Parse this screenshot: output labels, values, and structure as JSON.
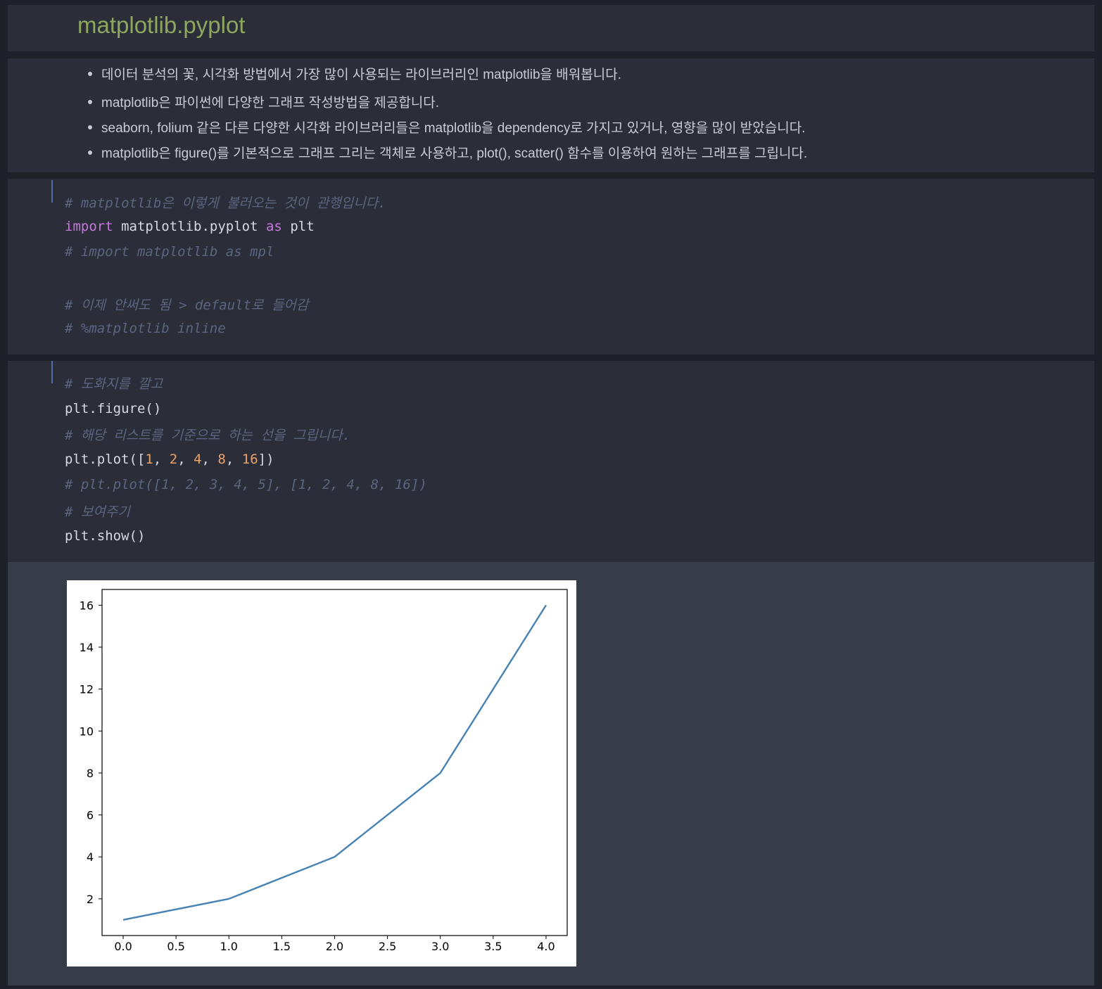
{
  "header": {
    "title": "matplotlib.pyplot"
  },
  "bullets": [
    "데이터 분석의 꽃, 시각화 방법에서 가장 많이 사용되는 라이브러리인 matplotlib을 배워봅니다.",
    "matplotlib은 파이썬에 다양한 그래프 작성방법을 제공합니다.",
    "seaborn, folium 같은 다른 다양한 시각화 라이브러리들은 matplotlib을 dependency로 가지고 있거나, 영향을 많이 받았습니다.",
    "matplotlib은 figure()를 기본적으로 그래프 그리는 객체로 사용하고, plot(), scatter() 함수를 이용하여 원하는 그래프를 그립니다."
  ],
  "code1": {
    "l1": "# matplotlib은 이렇게 불러오는 것이 관행입니다.",
    "l2_kw": "import",
    "l2_a": " matplotlib.pyplot ",
    "l2_as": "as",
    "l2_b": " plt",
    "l3": "# import matplotlib as mpl",
    "l4": "# 이제 안써도 됨 > default로 들어감",
    "l5": "# %matplotlib inline"
  },
  "code2": {
    "l1": "# 도화지를 깔고",
    "l2": "plt.figure()",
    "l3": "# 해당 리스트를 기준으로 하는 선을 그립니다.",
    "l4_a": "plt.plot([",
    "l4_n1": "1",
    "l4_c1": ", ",
    "l4_n2": "2",
    "l4_c2": ", ",
    "l4_n3": "4",
    "l4_c3": ", ",
    "l4_n4": "8",
    "l4_c4": ", ",
    "l4_n5": "16",
    "l4_b": "])",
    "l5": "# plt.plot([1, 2, 3, 4, 5], [1, 2, 4, 8, 16])",
    "l6": "# 보여주기",
    "l7": "plt.show()"
  },
  "colors": {
    "line": "#4682b4",
    "title": "#8fa65e"
  },
  "chart_data": {
    "type": "line",
    "x": [
      0,
      1,
      2,
      3,
      4
    ],
    "series": [
      {
        "values": [
          1,
          2,
          4,
          8,
          16
        ]
      }
    ],
    "xlim": [
      -0.2,
      4.2
    ],
    "ylim": [
      0.25,
      16.75
    ],
    "xticks": [
      "0.0",
      "0.5",
      "1.0",
      "1.5",
      "2.0",
      "2.5",
      "3.0",
      "3.5",
      "4.0"
    ],
    "yticks": [
      "2",
      "4",
      "6",
      "8",
      "10",
      "12",
      "14",
      "16"
    ],
    "grid": false
  }
}
